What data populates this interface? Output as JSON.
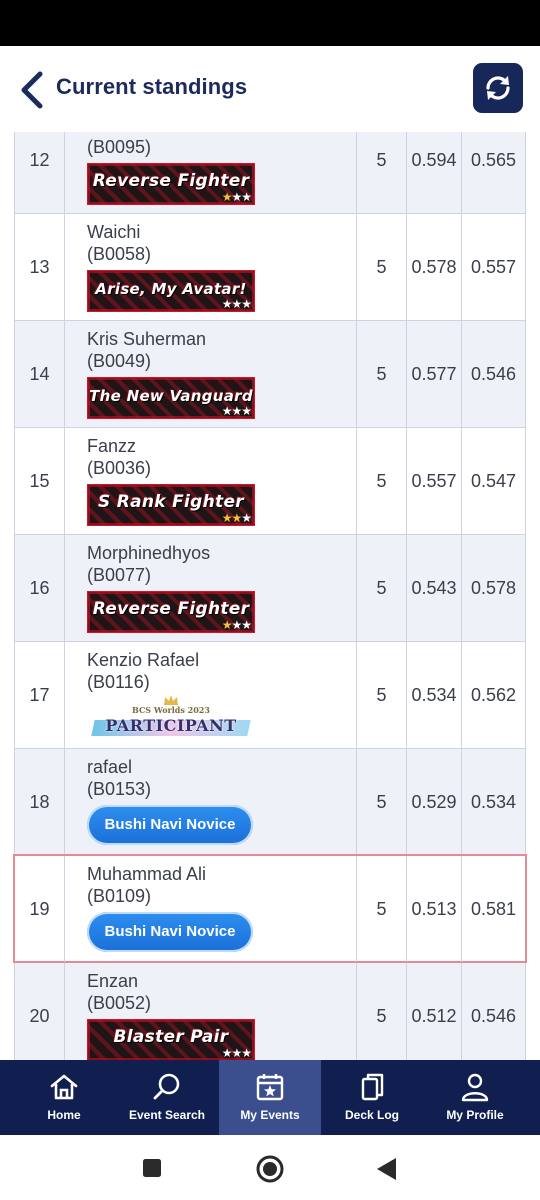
{
  "header": {
    "title": "Current standings"
  },
  "standings": [
    {
      "rank": "12",
      "name": "",
      "id": "(B0095)",
      "points": "5",
      "omw": "0.594",
      "oomw": "0.565",
      "badge": {
        "type": "red",
        "text": "Reverse Fighter",
        "gold_stars": 1,
        "white_stars": 2
      }
    },
    {
      "rank": "13",
      "name": "Waichi",
      "id": "(B0058)",
      "points": "5",
      "omw": "0.578",
      "oomw": "0.557",
      "badge": {
        "type": "red",
        "text": "Arise, My Avatar!",
        "gold_stars": 0,
        "white_stars": 3
      }
    },
    {
      "rank": "14",
      "name": "Kris Suherman",
      "id": "(B0049)",
      "points": "5",
      "omw": "0.577",
      "oomw": "0.546",
      "badge": {
        "type": "red",
        "text": "The New Vanguard",
        "gold_stars": 0,
        "white_stars": 3
      }
    },
    {
      "rank": "15",
      "name": "Fanzz",
      "id": "(B0036)",
      "points": "5",
      "omw": "0.557",
      "oomw": "0.547",
      "badge": {
        "type": "red",
        "text": "S Rank Fighter",
        "gold_stars": 2,
        "white_stars": 1
      }
    },
    {
      "rank": "16",
      "name": "Morphinedhyos",
      "id": "(B0077)",
      "points": "5",
      "omw": "0.543",
      "oomw": "0.578",
      "badge": {
        "type": "red",
        "text": "Reverse Fighter",
        "gold_stars": 1,
        "white_stars": 2
      }
    },
    {
      "rank": "17",
      "name": "Kenzio Rafael",
      "id": "(B0116)",
      "points": "5",
      "omw": "0.534",
      "oomw": "0.562",
      "badge": {
        "type": "participant",
        "text": "PARTICIPANT",
        "subtext": "BCS Worlds 2023"
      }
    },
    {
      "rank": "18",
      "name": "rafael",
      "id": "(B0153)",
      "points": "5",
      "omw": "0.529",
      "oomw": "0.534",
      "badge": {
        "type": "blue",
        "text": "Bushi Navi Novice"
      }
    },
    {
      "rank": "19",
      "name": "Muhammad Ali",
      "id": "(B0109)",
      "points": "5",
      "omw": "0.513",
      "oomw": "0.581",
      "badge": {
        "type": "blue",
        "text": "Bushi Navi Novice"
      },
      "highlight": true
    },
    {
      "rank": "20",
      "name": "Enzan",
      "id": "(B0052)",
      "points": "5",
      "omw": "0.512",
      "oomw": "0.546",
      "badge": {
        "type": "red",
        "text": "Blaster Pair",
        "gold_stars": 0,
        "white_stars": 3
      }
    }
  ],
  "bottom_nav": [
    {
      "label": "Home",
      "icon": "home-icon",
      "active": false
    },
    {
      "label": "Event Search",
      "icon": "search-icon",
      "active": false
    },
    {
      "label": "My Events",
      "icon": "calendar-star-icon",
      "active": true
    },
    {
      "label": "Deck Log",
      "icon": "cards-icon",
      "active": false
    },
    {
      "label": "My Profile",
      "icon": "profile-icon",
      "active": false
    }
  ],
  "colors": {
    "header_title": "#1b2b5c",
    "nav_bg": "#101f4f",
    "nav_active": "#3b4f8e",
    "row_alt": "#eef1f8",
    "highlight_border": "#e48a92"
  }
}
